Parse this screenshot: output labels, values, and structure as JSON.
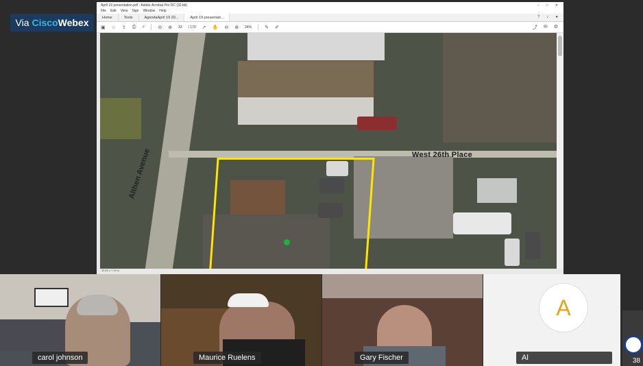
{
  "webex": {
    "via": "Via",
    "brand1": "Cisco",
    "brand2": "Webex"
  },
  "acrobat": {
    "title": "April 19 presentation.pdf - Adobe Acrobat Pro DC (32-bit)",
    "menus": [
      "File",
      "Edit",
      "View",
      "Sign",
      "Window",
      "Help"
    ],
    "tabs": [
      "Home",
      "Tools",
      "AgendaApril 19 20...",
      "April 19 presentati..."
    ],
    "page_current": "33",
    "page_total": "/ 170",
    "zoom": "24%",
    "status": "15.50 x 7.00 in",
    "labels": {
      "street": "West 26th Place",
      "avenue": "Althen Avenue"
    }
  },
  "participants": [
    {
      "name": "carol johnson"
    },
    {
      "name": "Maurice Ruelens"
    },
    {
      "name": "Gary Fischer"
    },
    {
      "name": "Al",
      "initial": "A"
    }
  ],
  "side": {
    "count": "38"
  },
  "colors": {
    "lot_outline": "#ffe600",
    "webex_accent": "#35b6e8",
    "avatar_initial": "#e8a318"
  }
}
